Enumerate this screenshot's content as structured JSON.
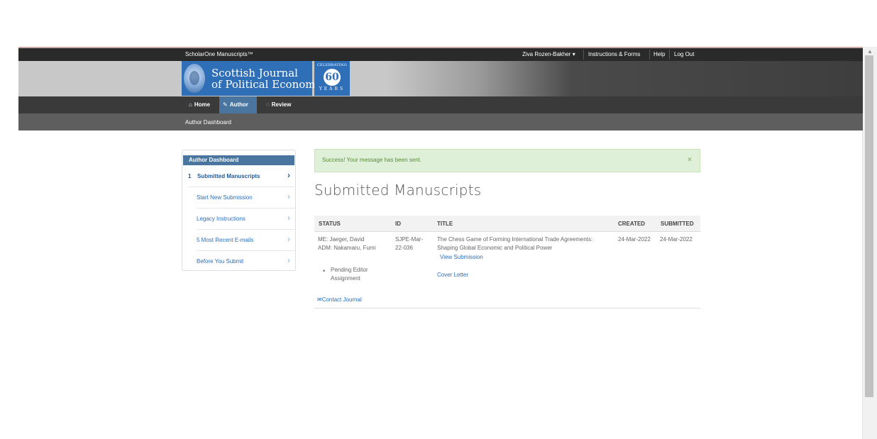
{
  "topbar": {
    "brand": "ScholarOne Manuscripts™",
    "user": "Ziva Rozen-Bakher ▾",
    "links": [
      "Instructions & Forms",
      "Help",
      "Log Out"
    ]
  },
  "banner": {
    "journal_line1": "Scottish Journal",
    "journal_line2": "of Political Economy",
    "celebrating": "CELEBRATING",
    "number": "60",
    "years": "YEARS"
  },
  "nav": {
    "home": "Home",
    "author": "Author",
    "review": "Review"
  },
  "breadcrumb": "Author Dashboard",
  "sidebar": {
    "title": "Author Dashboard",
    "items": [
      {
        "count": "1",
        "label": "Submitted Manuscripts"
      },
      {
        "label": "Start New Submission"
      },
      {
        "label": "Legacy Instructions"
      },
      {
        "label": "5 Most Recent E-mails"
      },
      {
        "label": "Before You Submit"
      }
    ]
  },
  "alert": {
    "message": "Success! Your message has been sent.",
    "close": "×"
  },
  "main": {
    "title": "Submitted Manuscripts",
    "columns": [
      "STATUS",
      "ID",
      "TITLE",
      "CREATED",
      "SUBMITTED"
    ],
    "row": {
      "status_me": "ME: Jaeger, David",
      "status_adm": "ADM: Nakamaru, Fumi",
      "status_pending": "Pending Editor Assignment",
      "id": "SJPE-Mar-22-036",
      "title": "The Chess Game of Forming International Trade Agreements: Shaping Global Economic and Political Power",
      "view": "View Submission",
      "cover": "Cover Letter",
      "created": "24-Mar-2022",
      "submitted": "24-Mar-2022",
      "contact": "Contact Journal"
    }
  },
  "colors": {
    "accent": "#49759f",
    "link": "#2a6ebb",
    "success_bg": "#dff0d8"
  }
}
